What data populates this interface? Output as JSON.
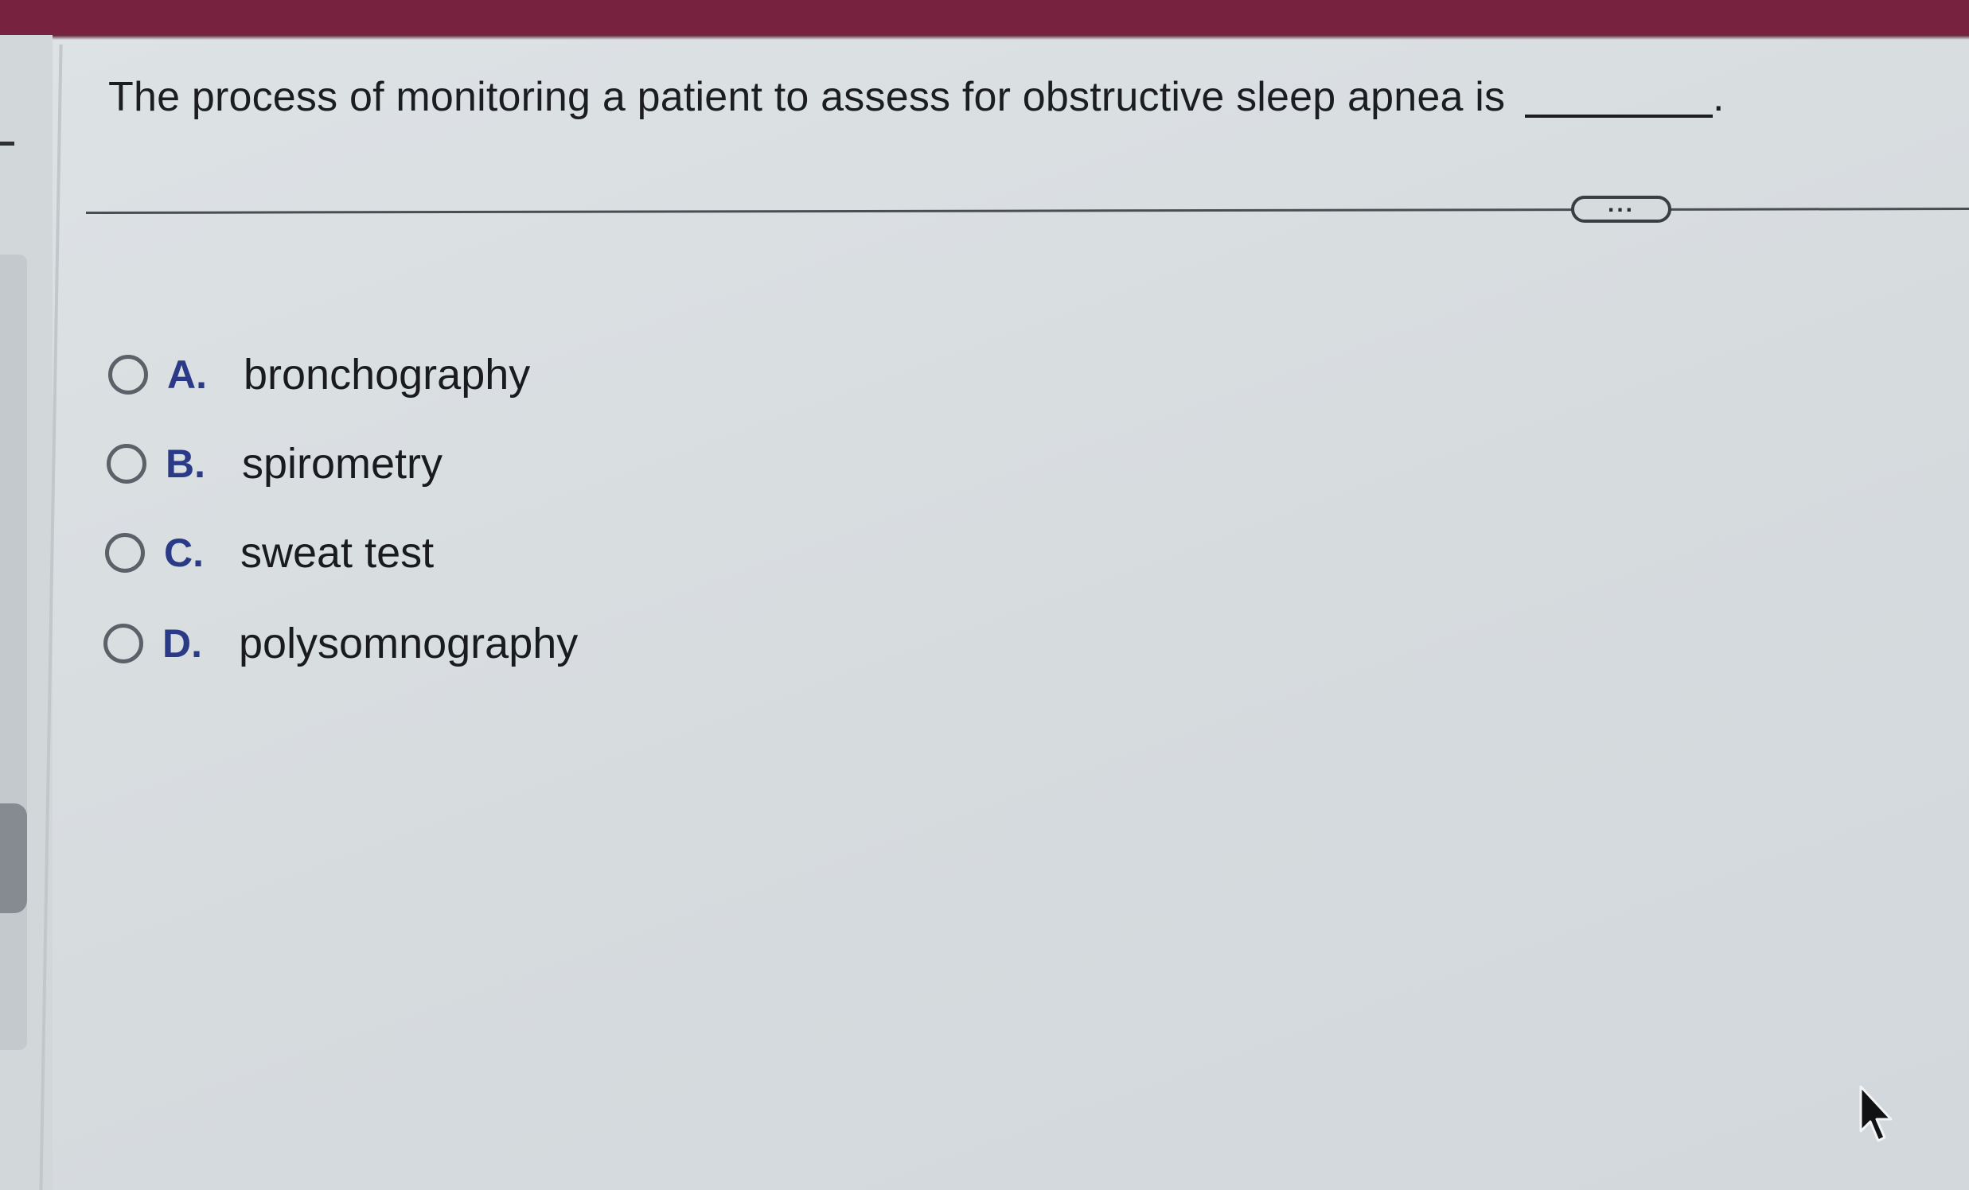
{
  "question": {
    "text": "The process of monitoring a patient to assess for obstructive sleep apnea is",
    "end_punctuation": "."
  },
  "expand_button": {
    "label": "..."
  },
  "options": [
    {
      "letter": "A.",
      "text": "bronchography",
      "selected": false
    },
    {
      "letter": "B.",
      "text": "spirometry",
      "selected": false
    },
    {
      "letter": "C.",
      "text": "sweat test",
      "selected": false
    },
    {
      "letter": "D.",
      "text": "polysomnography",
      "selected": false
    }
  ],
  "colors": {
    "header_bar": "#77233f",
    "option_letter": "#2a3a86",
    "background": "#d9dee1"
  },
  "icons": {
    "radio": "radio-button-empty",
    "cursor": "mouse-pointer-arrow",
    "expand": "ellipsis-pill"
  }
}
